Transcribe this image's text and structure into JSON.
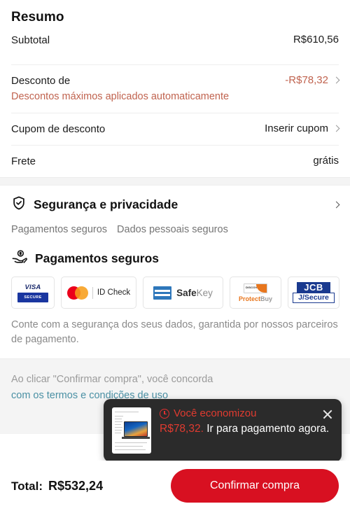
{
  "summary": {
    "title": "Resumo",
    "rows": [
      {
        "label": "Subtotal",
        "value": "R$610,56",
        "sub": "",
        "chevron": false
      },
      {
        "label": "Desconto de",
        "sub": "Descontos máximos aplicados automaticamente",
        "value": "-R$78,32",
        "chevron": true
      },
      {
        "label": "Cupom de desconto",
        "sub": "",
        "value": "Inserir cupom",
        "chevron": true
      },
      {
        "label": "Frete",
        "sub": "",
        "value": "grátis",
        "chevron": false
      }
    ]
  },
  "security": {
    "title": "Segurança e privacidade",
    "shield_icon": "shield-check-icon",
    "chevron_icon": "chevron-right-icon",
    "tags": [
      "Pagamentos seguros",
      "Dados pessoais seguros"
    ]
  },
  "payments": {
    "title": "Pagamentos seguros",
    "hand_icon": "hand-coin-icon",
    "badges": [
      {
        "name": "visa-secure",
        "word": "VISA",
        "chip": "SECURE"
      },
      {
        "name": "mastercard-id-check",
        "text": "ID Check"
      },
      {
        "name": "amex-safekey",
        "bold": "Safe",
        "light": "Key"
      },
      {
        "name": "discover-protectbuy",
        "card": "DISCOVER",
        "bold": "Protect",
        "light": "Buy"
      },
      {
        "name": "jcb-jsecure",
        "top": "JCB",
        "bottom": "J/Secure"
      }
    ],
    "note": "Conte com a segurança dos seus dados, garantida por nossos parceiros de pagamento."
  },
  "terms": {
    "line1": "Ao clicar \"Confirmar compra\", você concorda",
    "line2_link": "com os termos e condições de uso"
  },
  "tooltip": {
    "saved_label": "Você economizou",
    "amount": "R$78,32.",
    "cta": "Ir para pagamento agora.",
    "clock_icon": "clock-icon",
    "close_icon": "close-icon",
    "thumbnail_icon": "product-thumbnail"
  },
  "bottom": {
    "total_label": "Total:",
    "total_value": "R$532,24",
    "confirm_label": "Confirmar compra"
  },
  "colors": {
    "accent_red": "#d81021",
    "discount": "#c0634f",
    "link": "#4a90a4",
    "tooltip_bg": "#2b2b2b",
    "tooltip_red": "#e03b30"
  }
}
